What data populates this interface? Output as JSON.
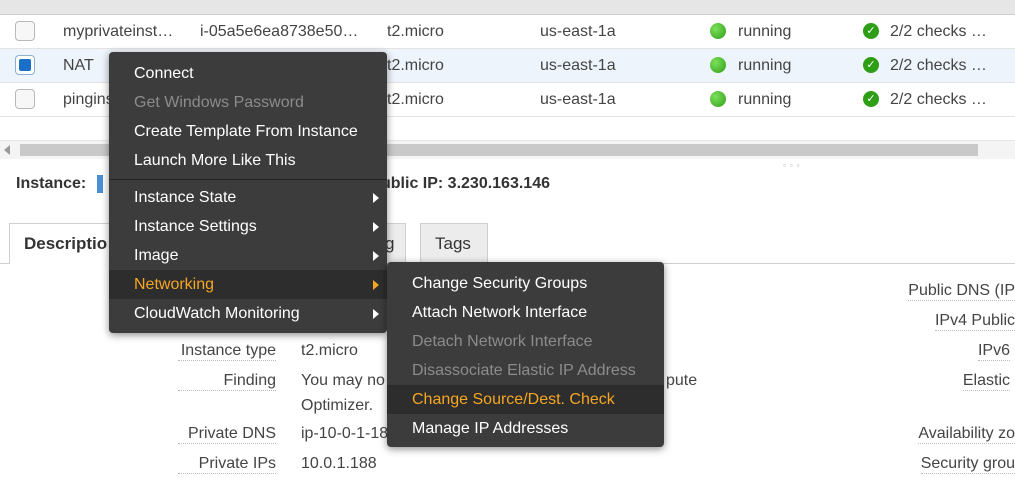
{
  "instances": [
    {
      "name": "myprivateinst…",
      "id": "i-05a5e6ea8738e50…",
      "type": "t2.micro",
      "az": "us-east-1a",
      "state": "running",
      "checks": "2/2 checks …",
      "selected": false
    },
    {
      "name": "NAT",
      "id": "",
      "type": "t2.micro",
      "az": "us-east-1a",
      "state": "running",
      "checks": "2/2 checks …",
      "selected": true
    },
    {
      "name": "pingins",
      "id": "",
      "type": "t2.micro",
      "az": "us-east-1a",
      "state": "running",
      "checks": "2/2 checks …",
      "selected": false
    }
  ],
  "instance_header": {
    "label": "Instance:",
    "public_ip": "ublic IP: 3.230.163.146"
  },
  "tabs": [
    {
      "label": "Descriptio",
      "active": true
    },
    {
      "label": "g",
      "active": false
    },
    {
      "label": "Tags",
      "active": false
    }
  ],
  "description": {
    "left": [
      {
        "label": "Instance type",
        "value": "t2.micro"
      },
      {
        "label": "Finding",
        "value": "You may no",
        "value2": "Optimizer.",
        "value_tail": "pute"
      },
      {
        "label": "Private DNS",
        "value": "ip-10-0-1-18"
      },
      {
        "label": "Private IPs",
        "value": "10.0.1.188"
      }
    ],
    "right_labels": [
      "Public DNS (IP",
      "IPv4 Public",
      "IPv6",
      "Elastic",
      "Availability zo",
      "Security grou"
    ]
  },
  "context_menu": {
    "items": [
      {
        "label": "Connect",
        "disabled": false
      },
      {
        "label": "Get Windows Password",
        "disabled": true
      },
      {
        "label": "Create Template From Instance",
        "disabled": false
      },
      {
        "label": "Launch More Like This",
        "disabled": false
      },
      {
        "label": "Instance State",
        "submenu": true
      },
      {
        "label": "Instance Settings",
        "submenu": true
      },
      {
        "label": "Image",
        "submenu": true
      },
      {
        "label": "Networking",
        "submenu": true,
        "highlighted": true
      },
      {
        "label": "CloudWatch Monitoring",
        "submenu": true
      }
    ]
  },
  "networking_submenu": {
    "items": [
      {
        "label": "Change Security Groups",
        "disabled": false
      },
      {
        "label": "Attach Network Interface",
        "disabled": false
      },
      {
        "label": "Detach Network Interface",
        "disabled": true
      },
      {
        "label": "Disassociate Elastic IP Address",
        "disabled": true
      },
      {
        "label": "Change Source/Dest. Check",
        "highlighted": true
      },
      {
        "label": "Manage IP Addresses",
        "disabled": false
      }
    ]
  },
  "colors": {
    "accent": "#f5a623",
    "menu_bg": "#3c3c3c",
    "status_green": "#2e9e17",
    "selected_checkbox": "#1a6fc9"
  }
}
